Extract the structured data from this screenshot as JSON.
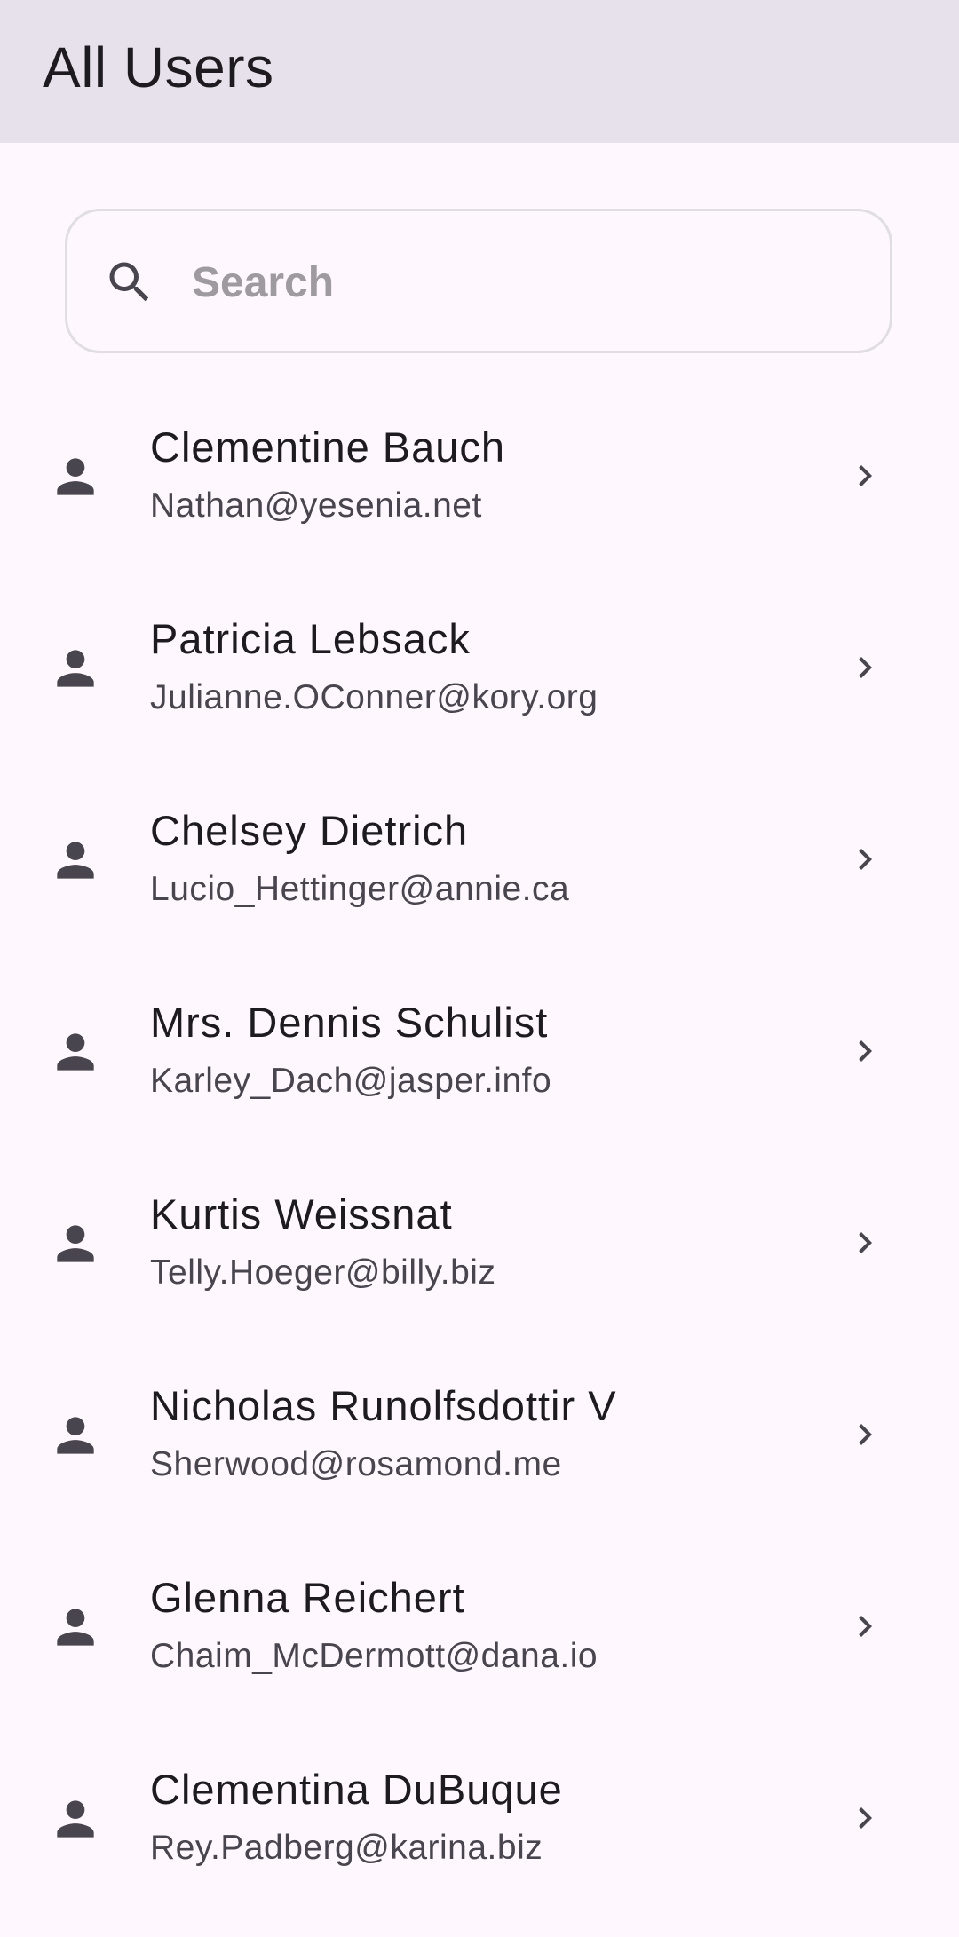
{
  "app_bar": {
    "title": "All Users",
    "background": "#e6e1ea"
  },
  "search": {
    "placeholder": "Search",
    "value": "",
    "icon": "search-icon"
  },
  "colors": {
    "page_background": "#fef7fd",
    "primary_text": "#1d1b20",
    "secondary_text": "#49454f",
    "icon": "#49454f"
  },
  "users": [
    {
      "name": "Clementine Bauch",
      "email": "Nathan@yesenia.net",
      "icon": "person-icon",
      "trailing_icon": "chevron-right-icon"
    },
    {
      "name": "Patricia Lebsack",
      "email": "Julianne.OConner@kory.org",
      "icon": "person-icon",
      "trailing_icon": "chevron-right-icon"
    },
    {
      "name": "Chelsey Dietrich",
      "email": "Lucio_Hettinger@annie.ca",
      "icon": "person-icon",
      "trailing_icon": "chevron-right-icon"
    },
    {
      "name": "Mrs. Dennis Schulist",
      "email": "Karley_Dach@jasper.info",
      "icon": "person-icon",
      "trailing_icon": "chevron-right-icon"
    },
    {
      "name": "Kurtis Weissnat",
      "email": "Telly.Hoeger@billy.biz",
      "icon": "person-icon",
      "trailing_icon": "chevron-right-icon"
    },
    {
      "name": "Nicholas Runolfsdottir V",
      "email": "Sherwood@rosamond.me",
      "icon": "person-icon",
      "trailing_icon": "chevron-right-icon"
    },
    {
      "name": "Glenna Reichert",
      "email": "Chaim_McDermott@dana.io",
      "icon": "person-icon",
      "trailing_icon": "chevron-right-icon"
    },
    {
      "name": "Clementina DuBuque",
      "email": "Rey.Padberg@karina.biz",
      "icon": "person-icon",
      "trailing_icon": "chevron-right-icon"
    }
  ]
}
